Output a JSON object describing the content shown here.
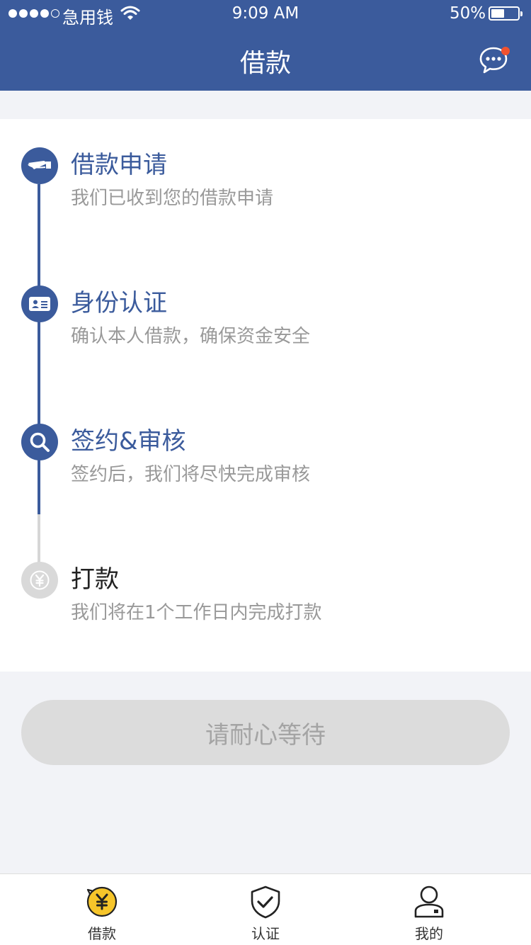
{
  "status_bar": {
    "carrier": "急用钱",
    "time": "9:09 AM",
    "battery": "50%",
    "battery_level": 0.5
  },
  "nav": {
    "title": "借款",
    "message_icon": "chat-bubble-icon",
    "has_unread": true
  },
  "steps": [
    {
      "title": "借款申请",
      "desc": "我们已收到您的借款申请",
      "icon": "loan-application-icon",
      "active": true
    },
    {
      "title": "身份认证",
      "desc": "确认本人借款，确保资金安全",
      "icon": "id-card-icon",
      "active": true
    },
    {
      "title": "签约&审核",
      "desc": "签约后，我们将尽快完成审核",
      "icon": "search-icon",
      "active": true
    },
    {
      "title": "打款",
      "desc": "我们将在1个工作日内完成打款",
      "icon": "yen-coin-icon",
      "active": false
    }
  ],
  "action_button": {
    "label": "请耐心等待"
  },
  "tabbar": {
    "tabs": [
      {
        "label": "借款",
        "icon": "yen-coin-icon"
      },
      {
        "label": "认证",
        "icon": "shield-check-icon"
      },
      {
        "label": "我的",
        "icon": "user-icon"
      }
    ]
  },
  "colors": {
    "primary": "#3b5b9c",
    "inactive": "#d9d9d9",
    "badge": "#f2522e",
    "tab_active_icon": "#f6c52a"
  }
}
